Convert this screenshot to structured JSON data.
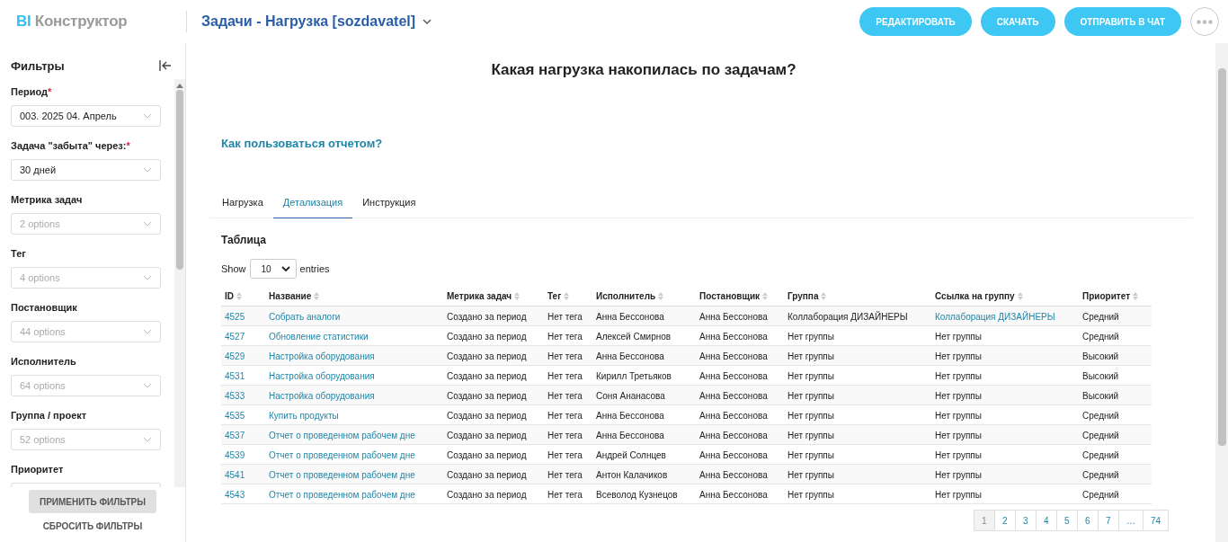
{
  "header": {
    "logo_accent": "BI",
    "logo_text": "Конструктор",
    "report_title": "Задачи - Нагрузка [sozdavatel]",
    "buttons": [
      "РЕДАКТИРОВАТЬ",
      "СКАЧАТЬ",
      "ОТПРАВИТЬ В ЧАТ"
    ]
  },
  "sidebar": {
    "title": "Фильтры",
    "filters": [
      {
        "label": "Период",
        "required_mark": "*",
        "value": "003. 2025 04. Апрель"
      },
      {
        "label": "Задача \"забыта\" через:",
        "required_mark": "*",
        "value": "30 дней"
      },
      {
        "label": "Метрика задач",
        "placeholder": "2 options"
      },
      {
        "label": "Тег",
        "placeholder": "4 options"
      },
      {
        "label": "Постановщик",
        "placeholder": "44 options"
      },
      {
        "label": "Исполнитель",
        "placeholder": "64 options"
      },
      {
        "label": "Группа / проект",
        "placeholder": "52 options"
      },
      {
        "label": "Приоритет"
      }
    ],
    "apply_button": "ПРИМЕНИТЬ ФИЛЬТРЫ",
    "reset_button": "СБРОСИТЬ ФИЛЬТРЫ"
  },
  "report": {
    "title": "Какая нагрузка накопилась по задачам?",
    "help_link": "Как пользоваться отчетом?",
    "tabs": [
      {
        "label": "Нагрузка",
        "selected": false
      },
      {
        "label": "Детализация",
        "selected": true
      },
      {
        "label": "Инструкция",
        "selected": false
      }
    ],
    "table_title": "Таблица",
    "show_label": "Show",
    "page_size": "10",
    "entries_label": "entries",
    "table": {
      "columns": [
        "ID",
        "Название",
        "Метрика задач",
        "Тег",
        "Исполнитель",
        "Постановщик",
        "Группа",
        "Ссылка на группу",
        "Приоритет"
      ],
      "rows": [
        {
          "cells": [
            "4525",
            "Собрать аналоги",
            "Создано за период",
            "Нет тега",
            "Анна Бессонова",
            "Анна Бессонова",
            "Коллаборация ДИЗАЙНЕРЫ",
            "Коллаборация ДИЗАЙНЕРЫ",
            "Средний"
          ],
          "group_is_link": true
        },
        {
          "cells": [
            "4527",
            "Обновление статистики",
            "Создано за период",
            "Нет тега",
            "Алексей Смирнов",
            "Анна Бессонова",
            "Нет группы",
            "Нет группы",
            "Средний"
          ],
          "group_is_link": false
        },
        {
          "cells": [
            "4529",
            "Настройка оборудования",
            "Создано за период",
            "Нет тега",
            "Анна Бессонова",
            "Анна Бессонова",
            "Нет группы",
            "Нет группы",
            "Высокий"
          ],
          "group_is_link": false
        },
        {
          "cells": [
            "4531",
            "Настройка оборудования",
            "Создано за период",
            "Нет тега",
            "Кирилл Третьяков",
            "Анна Бессонова",
            "Нет группы",
            "Нет группы",
            "Высокий"
          ],
          "group_is_link": false
        },
        {
          "cells": [
            "4533",
            "Настройка оборудования",
            "Создано за период",
            "Нет тега",
            "Соня Ананасова",
            "Анна Бессонова",
            "Нет группы",
            "Нет группы",
            "Высокий"
          ],
          "group_is_link": false
        },
        {
          "cells": [
            "4535",
            "Купить продукты",
            "Создано за период",
            "Нет тега",
            "Анна Бессонова",
            "Анна Бессонова",
            "Нет группы",
            "Нет группы",
            "Средний"
          ],
          "group_is_link": false
        },
        {
          "cells": [
            "4537",
            "Отчет о проведенном рабочем дне",
            "Создано за период",
            "Нет тега",
            "Анна Бессонова",
            "Анна Бессонова",
            "Нет группы",
            "Нет группы",
            "Средний"
          ],
          "group_is_link": false
        },
        {
          "cells": [
            "4539",
            "Отчет о проведенном рабочем дне",
            "Создано за период",
            "Нет тега",
            "Андрей Солнцев",
            "Анна Бессонова",
            "Нет группы",
            "Нет группы",
            "Средний"
          ],
          "group_is_link": false
        },
        {
          "cells": [
            "4541",
            "Отчет о проведенном рабочем дне",
            "Создано за период",
            "Нет тега",
            "Антон Калачиков",
            "Анна Бессонова",
            "Нет группы",
            "Нет группы",
            "Средний"
          ],
          "group_is_link": false
        },
        {
          "cells": [
            "4543",
            "Отчет о проведенном рабочем дне",
            "Создано за период",
            "Нет тега",
            "Всеволод Кузнецов",
            "Анна Бессонова",
            "Нет группы",
            "Нет группы",
            "Средний"
          ],
          "group_is_link": false
        }
      ]
    },
    "pagination": [
      {
        "label": "1",
        "selected": true
      },
      {
        "label": "2",
        "selected": false
      },
      {
        "label": "3",
        "selected": false
      },
      {
        "label": "4",
        "selected": false
      },
      {
        "label": "5",
        "selected": false
      },
      {
        "label": "6",
        "selected": false
      },
      {
        "label": "7",
        "selected": false
      },
      {
        "label": "…",
        "selected": false
      },
      {
        "label": "74",
        "selected": false
      }
    ]
  }
}
